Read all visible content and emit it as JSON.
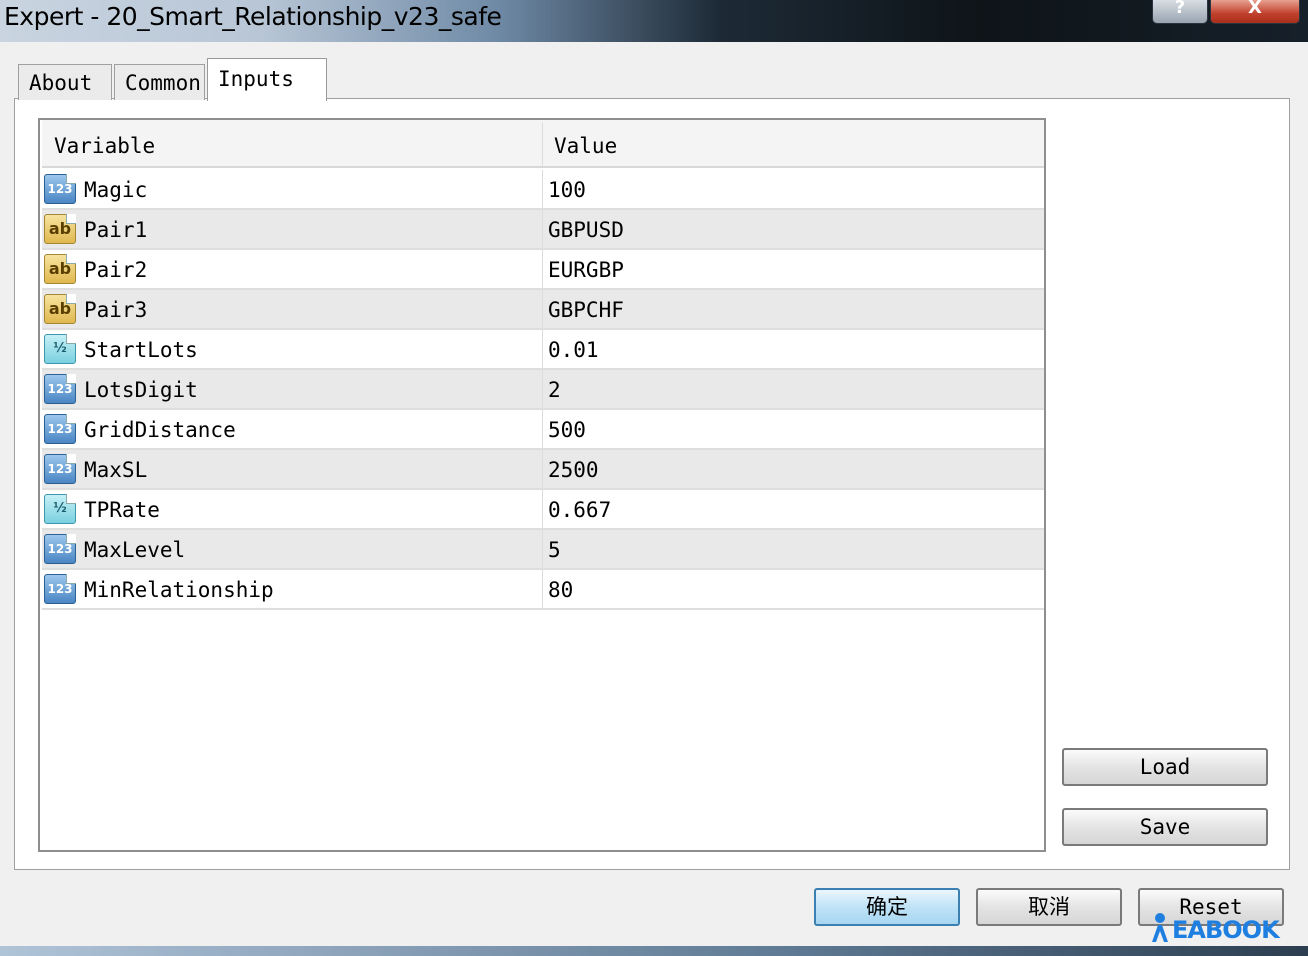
{
  "window": {
    "title": "Expert - 20_Smart_Relationship_v23_safe",
    "help_glyph": "?",
    "close_glyph": "X"
  },
  "tabs": [
    {
      "label": "About"
    },
    {
      "label": "Common"
    },
    {
      "label": "Inputs",
      "active": true
    }
  ],
  "grid": {
    "headers": {
      "variable": "Variable",
      "value": "Value"
    },
    "rows": [
      {
        "icon": "int-icon",
        "icon_glyph": "123",
        "name": "Magic",
        "value": "100"
      },
      {
        "icon": "string-icon",
        "icon_glyph": "ab",
        "name": "Pair1",
        "value": "GBPUSD"
      },
      {
        "icon": "string-icon",
        "icon_glyph": "ab",
        "name": "Pair2",
        "value": "EURGBP"
      },
      {
        "icon": "string-icon",
        "icon_glyph": "ab",
        "name": "Pair3",
        "value": "GBPCHF"
      },
      {
        "icon": "double-icon",
        "icon_glyph": "½",
        "name": "StartLots",
        "value": "0.01"
      },
      {
        "icon": "int-icon",
        "icon_glyph": "123",
        "name": "LotsDigit",
        "value": "2"
      },
      {
        "icon": "int-icon",
        "icon_glyph": "123",
        "name": "GridDistance",
        "value": "500"
      },
      {
        "icon": "int-icon",
        "icon_glyph": "123",
        "name": "MaxSL",
        "value": "2500"
      },
      {
        "icon": "double-icon",
        "icon_glyph": "½",
        "name": "TPRate",
        "value": "0.667"
      },
      {
        "icon": "int-icon",
        "icon_glyph": "123",
        "name": "MaxLevel",
        "value": "5"
      },
      {
        "icon": "int-icon",
        "icon_glyph": "123",
        "name": "MinRelationship",
        "value": "80"
      }
    ]
  },
  "buttons": {
    "load": "Load",
    "save": "Save",
    "ok": "确定",
    "cancel": "取消",
    "reset": "Reset"
  },
  "watermark": {
    "text": "EABOOK"
  },
  "colors": {
    "ok_border": "#3c7fb1",
    "int_icon": "#4a86c4",
    "string_icon": "#e0b850",
    "double_icon": "#7ad0e0",
    "watermark": "#1f7fe0"
  }
}
